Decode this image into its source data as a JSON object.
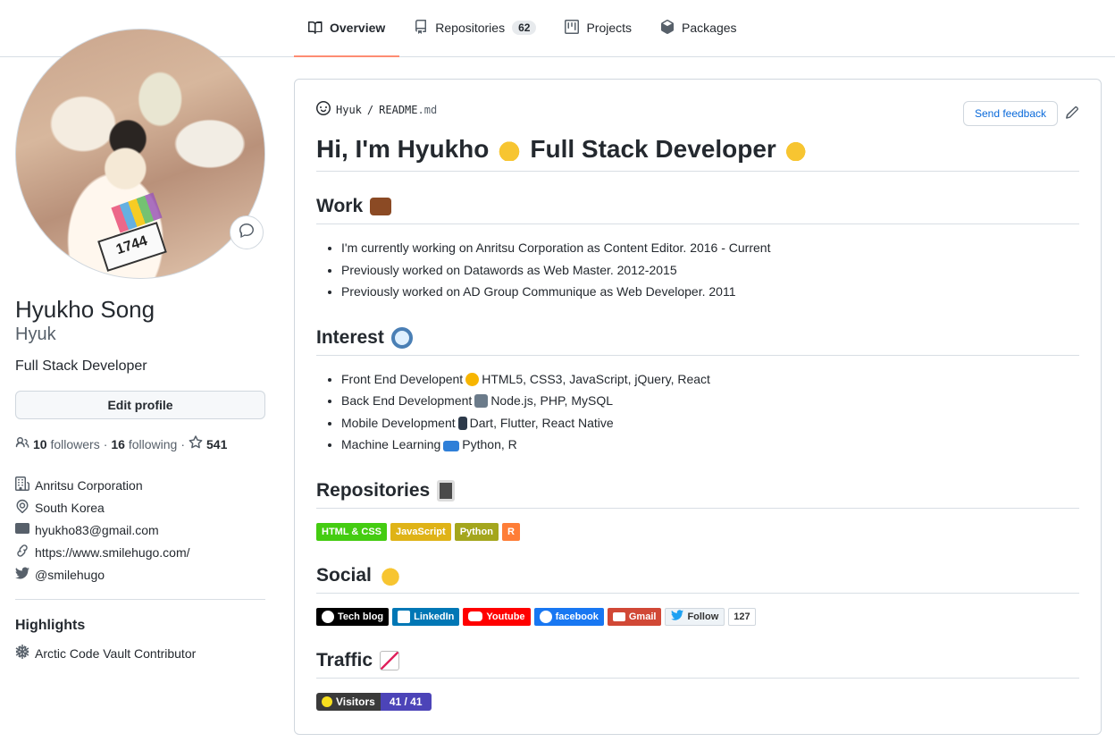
{
  "tabs": [
    {
      "label": "Overview",
      "icon": "book-icon"
    },
    {
      "label": "Repositories",
      "icon": "repo-icon",
      "count": "62"
    },
    {
      "label": "Projects",
      "icon": "project-icon"
    },
    {
      "label": "Packages",
      "icon": "package-icon"
    }
  ],
  "profile": {
    "name": "Hyukho Song",
    "login": "Hyuk",
    "bio": "Full Stack Developer",
    "edit_label": "Edit profile",
    "followers_count": "10",
    "followers_label": "followers",
    "following_count": "16",
    "following_label": "following",
    "stars_count": "541",
    "company": "Anritsu Corporation",
    "location": "South Korea",
    "email": "hyukho83@gmail.com",
    "website": "https://www.smilehugo.com/",
    "twitter": "@smilehugo",
    "avatar_bib": "1744"
  },
  "highlights": {
    "title": "Highlights",
    "items": [
      "Arctic Code Vault Contributor"
    ]
  },
  "readme": {
    "path_user": "Hyuk",
    "path_sep": "/",
    "path_file": "README",
    "path_ext": ".md",
    "feedback_label": "Send feedback",
    "heading_pre": "Hi, I'm Hyukho",
    "heading_post": "Full Stack Developer",
    "work_title": "Work",
    "work_items": [
      "I'm currently working on Anritsu Corporation as Content Editor. 2016 - Current",
      "Previously worked on Datawords as Web Master. 2012-2015",
      "Previously worked on AD Group Communique as Web Developer. 2011"
    ],
    "interest_title": "Interest",
    "interest_items": [
      {
        "pre": "Front End Developent",
        "post": "HTML5, CSS3, JavaScript, jQuery, React",
        "emoji_color": "#f7b500"
      },
      {
        "pre": "Back End Development",
        "post": "Node.js, PHP, MySQL",
        "emoji_color": "#6b7b8a"
      },
      {
        "pre": "Mobile Development",
        "post": "Dart, Flutter, React Native",
        "emoji_color": "#2d3a4a"
      },
      {
        "pre": "Machine Learning",
        "post": "Python, R",
        "emoji_color": "#2f7fd8"
      }
    ],
    "repos_title": "Repositories",
    "repo_badges": [
      {
        "label": "HTML & CSS",
        "color": "#4c1"
      },
      {
        "label": "JavaScript",
        "color": "#dfb317"
      },
      {
        "label": "Python",
        "color": "#a4a61d"
      },
      {
        "label": "R",
        "color": "#fe7d37"
      }
    ],
    "social_title": "Social",
    "social_badges": [
      {
        "label": "Tech blog",
        "color": "#000000"
      },
      {
        "label": "LinkedIn",
        "color": "#0077b5"
      },
      {
        "label": "Youtube",
        "color": "#ff0000"
      },
      {
        "label": "facebook",
        "color": "#1877f2"
      },
      {
        "label": "Gmail",
        "color": "#d14836"
      }
    ],
    "twitter_follow_label": "Follow",
    "twitter_follow_count": "127",
    "traffic_title": "Traffic",
    "visitors_label": "Visitors",
    "visitors_value": "41 / 41"
  }
}
